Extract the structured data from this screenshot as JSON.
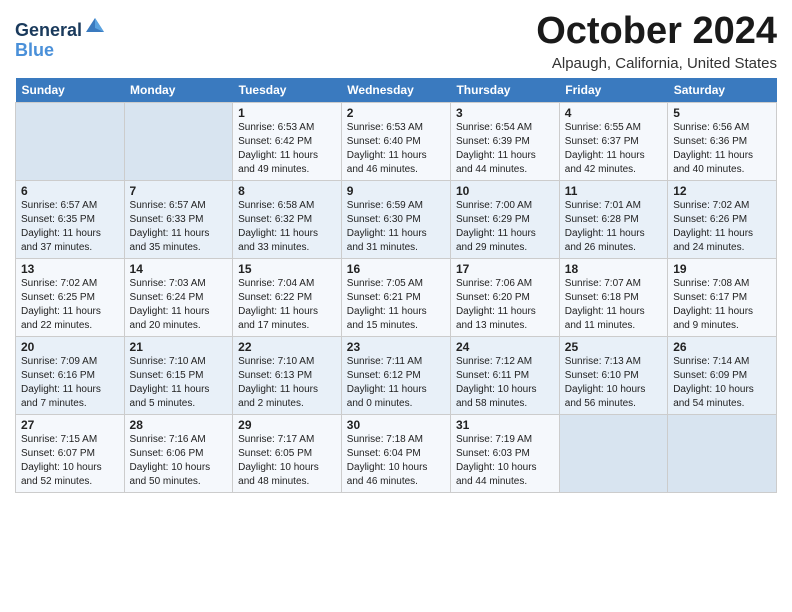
{
  "header": {
    "logo_line1": "General",
    "logo_line2": "Blue",
    "month": "October 2024",
    "location": "Alpaugh, California, United States"
  },
  "days_of_week": [
    "Sunday",
    "Monday",
    "Tuesday",
    "Wednesday",
    "Thursday",
    "Friday",
    "Saturday"
  ],
  "weeks": [
    [
      {
        "day": "",
        "sunrise": "",
        "sunset": "",
        "daylight": ""
      },
      {
        "day": "",
        "sunrise": "",
        "sunset": "",
        "daylight": ""
      },
      {
        "day": "1",
        "sunrise": "Sunrise: 6:53 AM",
        "sunset": "Sunset: 6:42 PM",
        "daylight": "Daylight: 11 hours and 49 minutes."
      },
      {
        "day": "2",
        "sunrise": "Sunrise: 6:53 AM",
        "sunset": "Sunset: 6:40 PM",
        "daylight": "Daylight: 11 hours and 46 minutes."
      },
      {
        "day": "3",
        "sunrise": "Sunrise: 6:54 AM",
        "sunset": "Sunset: 6:39 PM",
        "daylight": "Daylight: 11 hours and 44 minutes."
      },
      {
        "day": "4",
        "sunrise": "Sunrise: 6:55 AM",
        "sunset": "Sunset: 6:37 PM",
        "daylight": "Daylight: 11 hours and 42 minutes."
      },
      {
        "day": "5",
        "sunrise": "Sunrise: 6:56 AM",
        "sunset": "Sunset: 6:36 PM",
        "daylight": "Daylight: 11 hours and 40 minutes."
      }
    ],
    [
      {
        "day": "6",
        "sunrise": "Sunrise: 6:57 AM",
        "sunset": "Sunset: 6:35 PM",
        "daylight": "Daylight: 11 hours and 37 minutes."
      },
      {
        "day": "7",
        "sunrise": "Sunrise: 6:57 AM",
        "sunset": "Sunset: 6:33 PM",
        "daylight": "Daylight: 11 hours and 35 minutes."
      },
      {
        "day": "8",
        "sunrise": "Sunrise: 6:58 AM",
        "sunset": "Sunset: 6:32 PM",
        "daylight": "Daylight: 11 hours and 33 minutes."
      },
      {
        "day": "9",
        "sunrise": "Sunrise: 6:59 AM",
        "sunset": "Sunset: 6:30 PM",
        "daylight": "Daylight: 11 hours and 31 minutes."
      },
      {
        "day": "10",
        "sunrise": "Sunrise: 7:00 AM",
        "sunset": "Sunset: 6:29 PM",
        "daylight": "Daylight: 11 hours and 29 minutes."
      },
      {
        "day": "11",
        "sunrise": "Sunrise: 7:01 AM",
        "sunset": "Sunset: 6:28 PM",
        "daylight": "Daylight: 11 hours and 26 minutes."
      },
      {
        "day": "12",
        "sunrise": "Sunrise: 7:02 AM",
        "sunset": "Sunset: 6:26 PM",
        "daylight": "Daylight: 11 hours and 24 minutes."
      }
    ],
    [
      {
        "day": "13",
        "sunrise": "Sunrise: 7:02 AM",
        "sunset": "Sunset: 6:25 PM",
        "daylight": "Daylight: 11 hours and 22 minutes."
      },
      {
        "day": "14",
        "sunrise": "Sunrise: 7:03 AM",
        "sunset": "Sunset: 6:24 PM",
        "daylight": "Daylight: 11 hours and 20 minutes."
      },
      {
        "day": "15",
        "sunrise": "Sunrise: 7:04 AM",
        "sunset": "Sunset: 6:22 PM",
        "daylight": "Daylight: 11 hours and 17 minutes."
      },
      {
        "day": "16",
        "sunrise": "Sunrise: 7:05 AM",
        "sunset": "Sunset: 6:21 PM",
        "daylight": "Daylight: 11 hours and 15 minutes."
      },
      {
        "day": "17",
        "sunrise": "Sunrise: 7:06 AM",
        "sunset": "Sunset: 6:20 PM",
        "daylight": "Daylight: 11 hours and 13 minutes."
      },
      {
        "day": "18",
        "sunrise": "Sunrise: 7:07 AM",
        "sunset": "Sunset: 6:18 PM",
        "daylight": "Daylight: 11 hours and 11 minutes."
      },
      {
        "day": "19",
        "sunrise": "Sunrise: 7:08 AM",
        "sunset": "Sunset: 6:17 PM",
        "daylight": "Daylight: 11 hours and 9 minutes."
      }
    ],
    [
      {
        "day": "20",
        "sunrise": "Sunrise: 7:09 AM",
        "sunset": "Sunset: 6:16 PM",
        "daylight": "Daylight: 11 hours and 7 minutes."
      },
      {
        "day": "21",
        "sunrise": "Sunrise: 7:10 AM",
        "sunset": "Sunset: 6:15 PM",
        "daylight": "Daylight: 11 hours and 5 minutes."
      },
      {
        "day": "22",
        "sunrise": "Sunrise: 7:10 AM",
        "sunset": "Sunset: 6:13 PM",
        "daylight": "Daylight: 11 hours and 2 minutes."
      },
      {
        "day": "23",
        "sunrise": "Sunrise: 7:11 AM",
        "sunset": "Sunset: 6:12 PM",
        "daylight": "Daylight: 11 hours and 0 minutes."
      },
      {
        "day": "24",
        "sunrise": "Sunrise: 7:12 AM",
        "sunset": "Sunset: 6:11 PM",
        "daylight": "Daylight: 10 hours and 58 minutes."
      },
      {
        "day": "25",
        "sunrise": "Sunrise: 7:13 AM",
        "sunset": "Sunset: 6:10 PM",
        "daylight": "Daylight: 10 hours and 56 minutes."
      },
      {
        "day": "26",
        "sunrise": "Sunrise: 7:14 AM",
        "sunset": "Sunset: 6:09 PM",
        "daylight": "Daylight: 10 hours and 54 minutes."
      }
    ],
    [
      {
        "day": "27",
        "sunrise": "Sunrise: 7:15 AM",
        "sunset": "Sunset: 6:07 PM",
        "daylight": "Daylight: 10 hours and 52 minutes."
      },
      {
        "day": "28",
        "sunrise": "Sunrise: 7:16 AM",
        "sunset": "Sunset: 6:06 PM",
        "daylight": "Daylight: 10 hours and 50 minutes."
      },
      {
        "day": "29",
        "sunrise": "Sunrise: 7:17 AM",
        "sunset": "Sunset: 6:05 PM",
        "daylight": "Daylight: 10 hours and 48 minutes."
      },
      {
        "day": "30",
        "sunrise": "Sunrise: 7:18 AM",
        "sunset": "Sunset: 6:04 PM",
        "daylight": "Daylight: 10 hours and 46 minutes."
      },
      {
        "day": "31",
        "sunrise": "Sunrise: 7:19 AM",
        "sunset": "Sunset: 6:03 PM",
        "daylight": "Daylight: 10 hours and 44 minutes."
      },
      {
        "day": "",
        "sunrise": "",
        "sunset": "",
        "daylight": ""
      },
      {
        "day": "",
        "sunrise": "",
        "sunset": "",
        "daylight": ""
      }
    ]
  ]
}
